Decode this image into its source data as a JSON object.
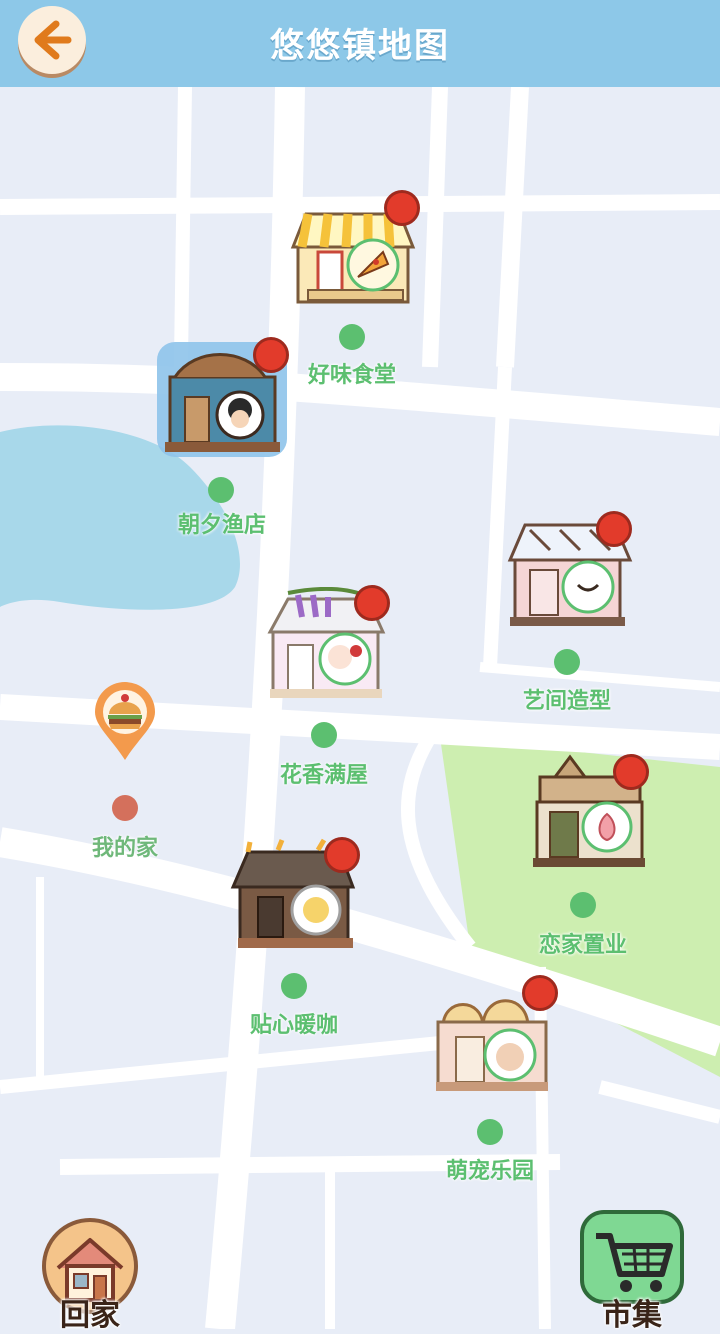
{
  "header": {
    "title": "悠悠镇地图",
    "back_icon": "arrow-left-icon"
  },
  "locations": [
    {
      "id": "haowei",
      "name": "好味食堂",
      "icon": "pizza-icon",
      "has_badge": true
    },
    {
      "id": "zhaoxi",
      "name": "朝夕渔店",
      "icon": "fisherman-icon",
      "has_badge": true
    },
    {
      "id": "yijian",
      "name": "艺间造型",
      "icon": "smile-face-icon",
      "has_badge": true
    },
    {
      "id": "huaxiang",
      "name": "花香满屋",
      "icon": "cat-rose-icon",
      "has_badge": true
    },
    {
      "id": "home",
      "name": "我的家",
      "icon": "burger-pin-icon",
      "has_badge": false
    },
    {
      "id": "lianjia",
      "name": "恋家置业",
      "icon": "lotus-icon",
      "has_badge": true
    },
    {
      "id": "tiexin",
      "name": "贴心暖咖",
      "icon": "sun-face-icon",
      "has_badge": true
    },
    {
      "id": "mengchong",
      "name": "萌宠乐园",
      "icon": "cat-icon",
      "has_badge": true
    }
  ],
  "bottom": {
    "home_label": "回家",
    "home_icon": "house-icon",
    "market_label": "市集",
    "market_icon": "shopping-cart-icon"
  },
  "colors": {
    "header": "#8dc8e8",
    "map_bg": "#e8edf7",
    "road": "#ffffff",
    "lake": "#a8d8ea",
    "park": "#cdeeb0",
    "label_green": "#5cbf70",
    "home_dot": "#d4705c",
    "badge_red": "#e23b2b"
  }
}
